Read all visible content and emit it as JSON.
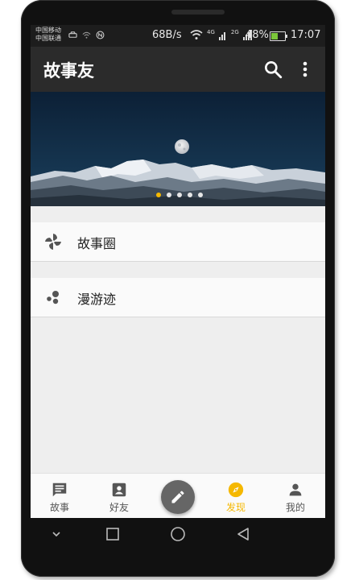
{
  "status_bar": {
    "carrier_line1": "中国移动",
    "carrier_line2": "中国联通",
    "net_speed": "68B/s",
    "net_4g": "4G",
    "net_2g": "2G",
    "battery_percent": "48%",
    "battery_level": 0.48,
    "time": "17:07"
  },
  "app_bar": {
    "title": "故事友"
  },
  "banner": {
    "page_count": 5,
    "active_index": 0
  },
  "list": {
    "items": [
      {
        "label": "故事圈",
        "icon": "pinwheel-icon"
      },
      {
        "label": "漫游迹",
        "icon": "dots-icon"
      }
    ]
  },
  "bottom_nav": {
    "items": [
      {
        "label": "故事",
        "icon": "story-icon",
        "active": false
      },
      {
        "label": "好友",
        "icon": "contacts-icon",
        "active": false
      },
      {
        "label": "发现",
        "icon": "compass-icon",
        "active": true
      },
      {
        "label": "我的",
        "icon": "person-icon",
        "active": false
      }
    ],
    "fab_icon": "pencil-icon"
  },
  "colors": {
    "accent": "#f5b800",
    "app_bar": "#2b2b2b",
    "background": "#eeeeee"
  }
}
